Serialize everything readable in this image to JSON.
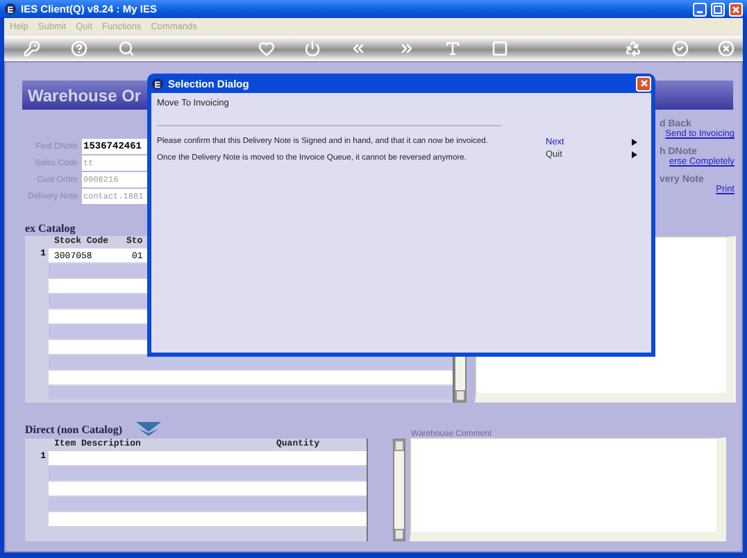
{
  "window": {
    "title": "IES Client(Q) v8.24 : My IES"
  },
  "menu": [
    {
      "label": "Help",
      "disabled": true
    },
    {
      "label": "Submit",
      "disabled": true
    },
    {
      "label": "Quit",
      "disabled": true
    },
    {
      "label": "Functions",
      "disabled": true
    },
    {
      "label": "Commands",
      "disabled": true
    }
  ],
  "header": {
    "title": "Warehouse Or"
  },
  "fields": [
    {
      "label": "Find DNote",
      "value": "1536742461",
      "disabled": false
    },
    {
      "label": "Sales Code",
      "value": "tt",
      "disabled": true
    },
    {
      "label": "Cust Order",
      "value": "0008216",
      "disabled": true
    },
    {
      "label": "Delivery Note",
      "value": "contact.1881",
      "disabled": true
    }
  ],
  "actions": [
    {
      "kind": "heading",
      "text": "d Back"
    },
    {
      "kind": "link",
      "text": "Send to Invoicing"
    },
    {
      "kind": "heading",
      "text": "h DNote"
    },
    {
      "kind": "link",
      "text": "erse Completely"
    },
    {
      "kind": "heading",
      "text": "very Note"
    },
    {
      "kind": "link",
      "text": "Print"
    }
  ],
  "catalog": {
    "title": "ex Catalog",
    "columns": [
      "Stock Code",
      "Sto"
    ],
    "rows": [
      {
        "number": "1",
        "cells": [
          "3007058",
          "01"
        ]
      }
    ]
  },
  "direct": {
    "title": "Direct (non Catalog)",
    "columns": [
      "Item Description",
      "Quantity"
    ],
    "rows": [
      {
        "number": "1",
        "cells": []
      }
    ]
  },
  "comment": {
    "label": "Warehouse Comment"
  },
  "dialog": {
    "title": "Selection Dialog",
    "heading": "Move To Invoicing",
    "messages": [
      "Please confirm that this Delivery Note is Signed and in hand, and that it can now be invoiced.",
      "Once the Delivery Note is moved to the Invoice Queue, it cannot be reversed anymore."
    ],
    "options": [
      {
        "label": "Next",
        "selected": true
      },
      {
        "label": "Quit",
        "selected": false
      }
    ]
  }
}
